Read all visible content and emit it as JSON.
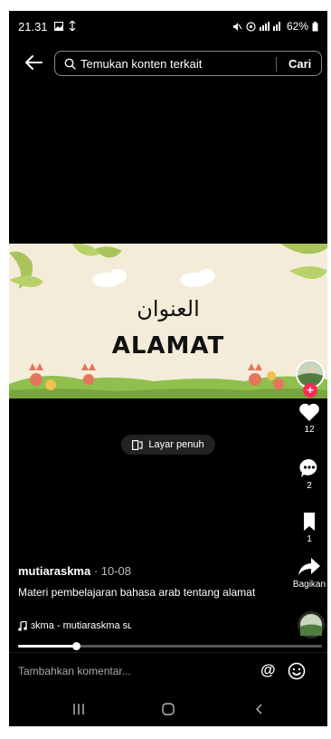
{
  "status_bar": {
    "time": "21.31",
    "battery": "62%"
  },
  "search": {
    "query": "Temukan konten terkait",
    "button_label": "Cari"
  },
  "video": {
    "arabic_text": "العنوان",
    "title_text": "ALAMAT",
    "fullscreen_label": "Layar penuh"
  },
  "rail": {
    "likes": "12",
    "comments": "2",
    "saves": "1",
    "share_label": "Bagikan"
  },
  "post": {
    "author": "mutiaraskma",
    "date": " · 10-08",
    "description": "Materi pembelajaran bahasa arab tentang alamat",
    "music": "ɜkma - mutiaraskma   sʟ"
  },
  "playback": {
    "progress": 0.19
  },
  "comment": {
    "placeholder": "Tambahkan komentar..."
  },
  "colors": {
    "background": "#000000",
    "accent": "#fe2c55",
    "video_bg": "#f4ecd9"
  }
}
